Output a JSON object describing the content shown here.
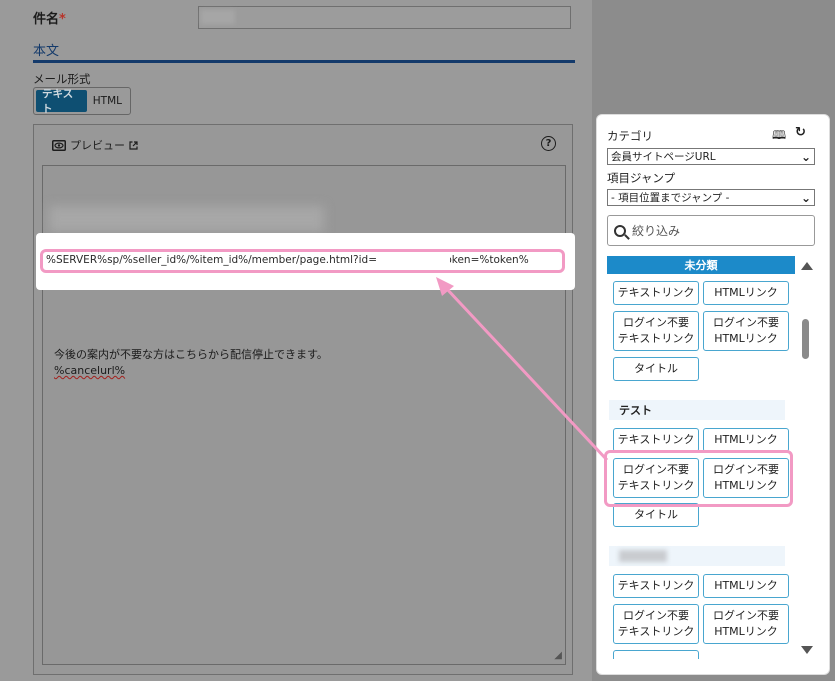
{
  "form": {
    "subject_label": "件名",
    "required_mark": "*",
    "body_section_title": "本文",
    "mail_format_label": "メール形式",
    "format_options": [
      "テキスト",
      "HTML"
    ],
    "format_selected": "テキスト"
  },
  "editor": {
    "preview_label": "プレビュー",
    "help_symbol": "?",
    "url_line": "%SERVER%sp/%seller_id%/%item_id%/member/page.html?id=",
    "url_tail": "&token=%token%",
    "unsubscribe_text": "今後の案内が不要な方はこちらから配信停止できます。",
    "cancel_url": "%cancelurl%"
  },
  "panel": {
    "category_label": "カテゴリ",
    "category_value": "会員サイトページURL",
    "jump_label": "項目ジャンプ",
    "jump_value": "- 項目位置までジャンプ -",
    "search_placeholder": "絞り込み",
    "group_uncategorized": "未分類",
    "group_test": "テスト",
    "buttons": {
      "text_link": "テキストリンク",
      "html_link": "HTMLリンク",
      "login_free": "ログイン不要",
      "title": "タイトル"
    }
  },
  "colors": {
    "highlight": "#f29ac4",
    "accent_blue": "#1c8ac9",
    "button_border": "#49a6cf",
    "toggle_active": "#0e4f72",
    "section_rule": "#143a6b"
  },
  "icons": [
    "eye-icon",
    "external-link-icon",
    "help-icon",
    "dictionary-icon",
    "reload-icon",
    "search-icon",
    "chevron-down-icon",
    "scroll-up-icon",
    "scroll-down-icon",
    "resize-handle-icon"
  ]
}
